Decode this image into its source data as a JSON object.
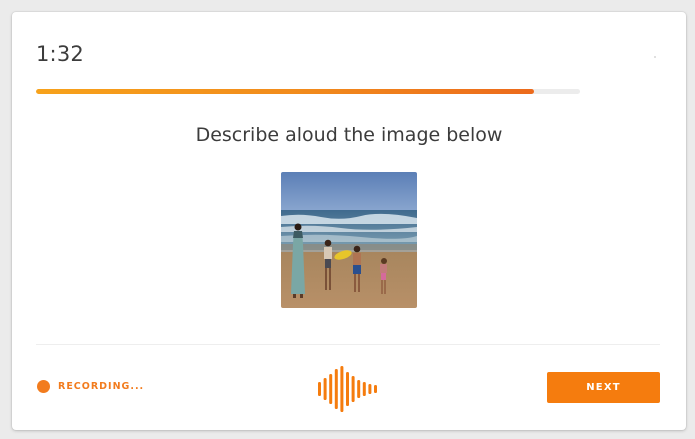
{
  "timer": {
    "value": "1:32"
  },
  "progress": {
    "fraction": 0.915
  },
  "prompt": {
    "text": "Describe aloud the image below"
  },
  "image": {
    "subject": "beach-scene"
  },
  "status": {
    "recording_label": "RECORDING..."
  },
  "actions": {
    "next_label": "NEXT"
  },
  "colors": {
    "accent": "#f57c0e",
    "progress_start": "#f7a21b",
    "progress_end": "#ec6a1c",
    "text": "#3c3c3c"
  }
}
